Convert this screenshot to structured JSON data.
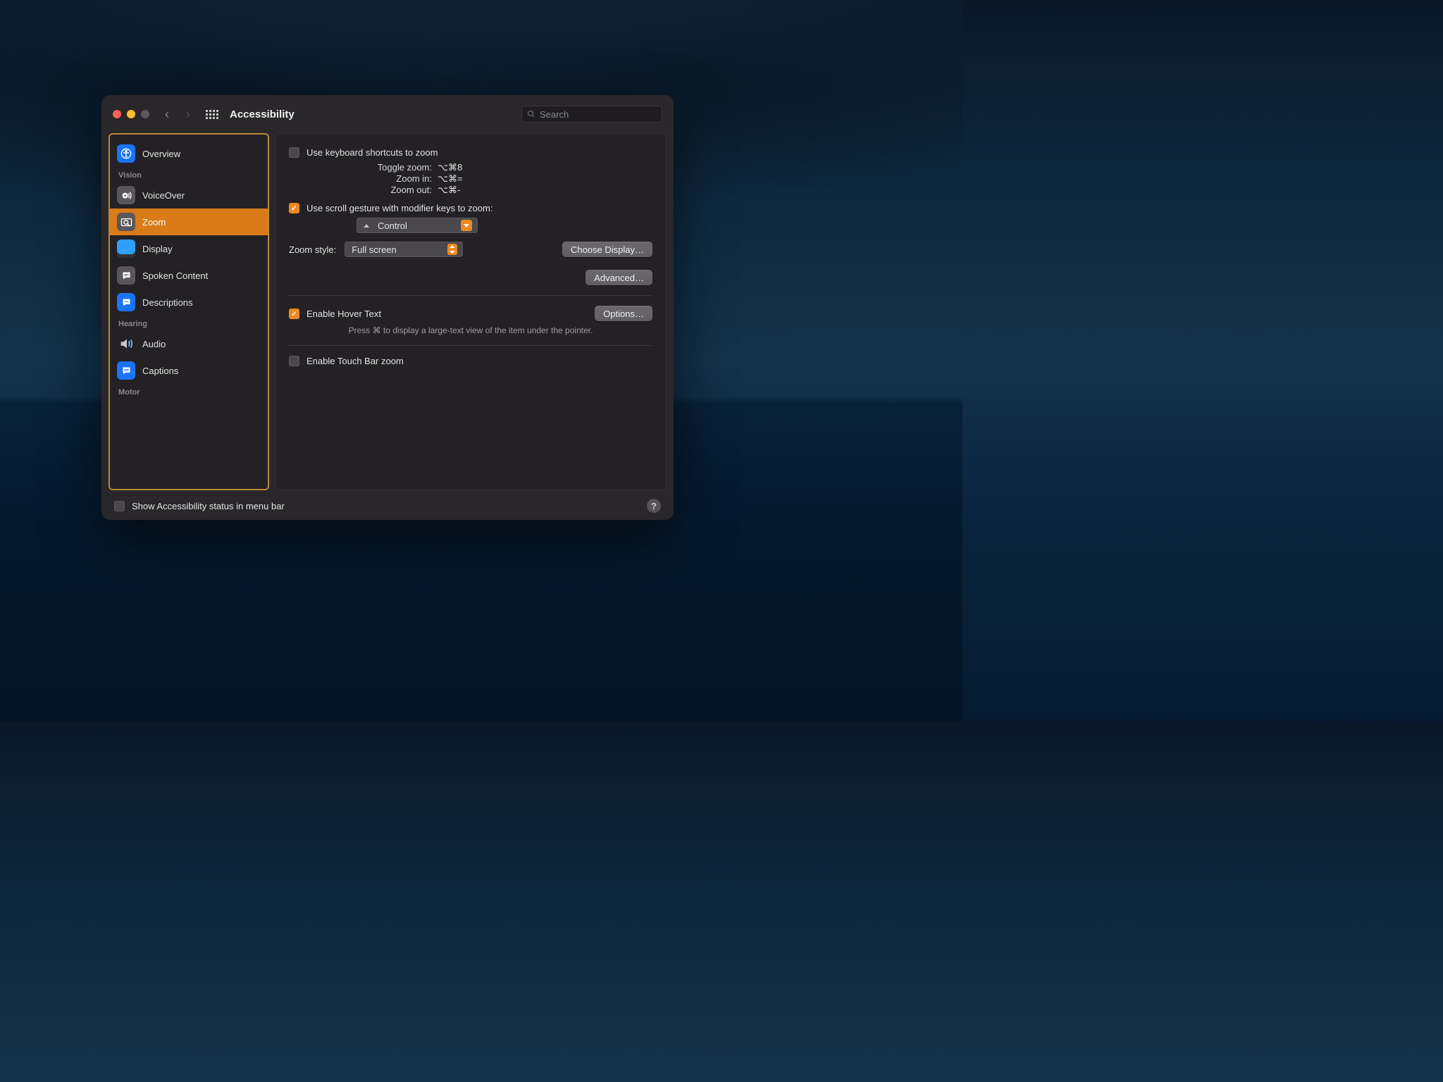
{
  "window": {
    "title": "Accessibility",
    "search_placeholder": "Search"
  },
  "sidebar": {
    "groups": [
      {
        "label_key": "g0",
        "label": "",
        "items": [
          {
            "label": "Overview",
            "selected": false,
            "icon": "accessibility-icon",
            "color": "blue"
          }
        ]
      },
      {
        "label_key": "g1",
        "label": "Vision",
        "items": [
          {
            "label": "VoiceOver",
            "icon": "voiceover-icon",
            "color": "gray"
          },
          {
            "label": "Zoom",
            "icon": "zoom-icon",
            "color": "gray",
            "selected": true
          },
          {
            "label": "Display",
            "icon": "display-icon",
            "color": "display"
          },
          {
            "label": "Spoken Content",
            "icon": "speech-icon",
            "color": "gray"
          },
          {
            "label": "Descriptions",
            "icon": "descriptions-icon",
            "color": "blue"
          }
        ]
      },
      {
        "label_key": "g2",
        "label": "Hearing",
        "items": [
          {
            "label": "Audio",
            "icon": "audio-icon",
            "color": "gray"
          },
          {
            "label": "Captions",
            "icon": "captions-icon",
            "color": "blue"
          }
        ]
      },
      {
        "label_key": "g3",
        "label": "Motor",
        "items": []
      }
    ]
  },
  "main": {
    "use_keyboard_shortcuts_label": "Use keyboard shortcuts to zoom",
    "shortcuts": [
      {
        "label": "Toggle zoom:",
        "keys": "⌥⌘8"
      },
      {
        "label": "Zoom in:",
        "keys": "⌥⌘="
      },
      {
        "label": "Zoom out:",
        "keys": "⌥⌘-"
      }
    ],
    "use_scroll_label": "Use scroll gesture with modifier keys to zoom:",
    "modifier_popup_value": "Control",
    "zoom_style_label": "Zoom style:",
    "zoom_style_value": "Full screen",
    "choose_display_label": "Choose Display…",
    "advanced_label": "Advanced…",
    "enable_hover_label": "Enable Hover Text",
    "options_label": "Options…",
    "hover_hint": "Press ⌘ to display a large-text view of the item under the pointer.",
    "enable_touchbar_label": "Enable Touch Bar zoom"
  },
  "footer": {
    "menubar_label": "Show Accessibility status in menu bar"
  }
}
